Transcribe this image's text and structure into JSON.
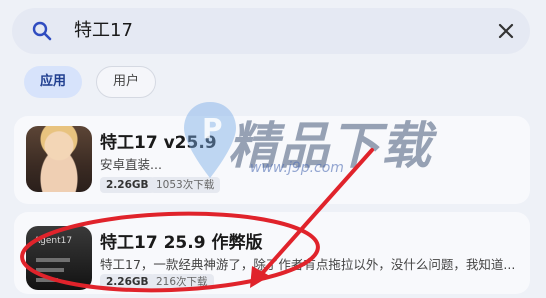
{
  "search": {
    "query": "特工17"
  },
  "tabs": [
    {
      "label": "应用",
      "active": true
    },
    {
      "label": "用户",
      "active": false
    }
  ],
  "results": [
    {
      "title": "特工17 v25.9",
      "description": "安卓直装...",
      "size": "2.26GB",
      "downloads": "1053次下载"
    },
    {
      "title": "特工17 25.9 作弊版",
      "description": "特工17，一款经典神游了，除了作者有点拖拉以外，没什么问题，我知道...",
      "size": "2.26GB",
      "downloads": "216次下载",
      "thumb_text": "Agent17"
    }
  ],
  "watermark": {
    "text": "精品下载",
    "url": "www.j9p.com"
  },
  "colors": {
    "annotation": "#e0232b",
    "accent": "#1f3e8f",
    "chip_active_bg": "#d7e3fb"
  }
}
